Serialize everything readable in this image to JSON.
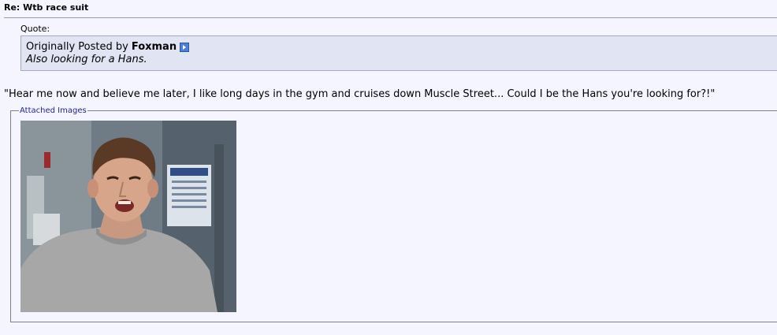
{
  "post": {
    "title": "Re: Wtb race suit"
  },
  "quote": {
    "label": "Quote:",
    "prefix": "Originally Posted by",
    "author": "Foxman",
    "text": "Also looking for a Hans."
  },
  "message": {
    "text": "\"Hear me now and believe me later, I like long days in the gym and cruises down Muscle Street... Could I be the Hans you're looking for?!\""
  },
  "attachments": {
    "legend": "Attached Images"
  },
  "colors": {
    "page_bg": "#f5f5ff",
    "quote_bg": "#e1e4f2",
    "legend_text": "#22229c",
    "view_post_icon": "#4c7fd6"
  },
  "icons": {
    "view_post": "view-post-arrow-icon"
  }
}
